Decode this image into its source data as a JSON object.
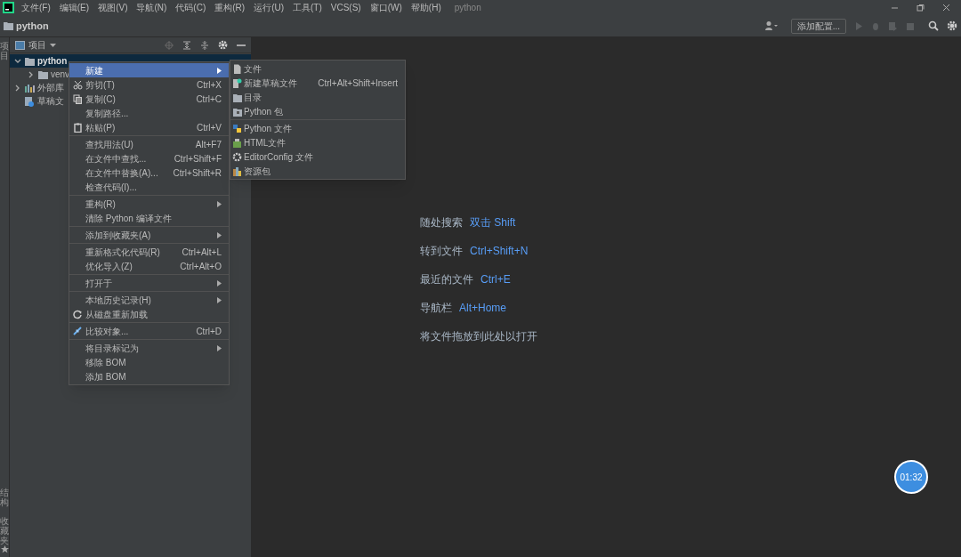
{
  "menu_bar": {
    "items": [
      "文件(F)",
      "编辑(E)",
      "视图(V)",
      "导航(N)",
      "代码(C)",
      "重构(R)",
      "运行(U)",
      "工具(T)",
      "VCS(S)",
      "窗口(W)",
      "帮助(H)"
    ],
    "title": "python"
  },
  "nav_bar": {
    "breadcrumb": "python",
    "config_button": "添加配置..."
  },
  "left_stripe": {
    "tabs": [
      "项目",
      "结构",
      "收藏夹"
    ]
  },
  "project_panel": {
    "title": "项目",
    "tree": [
      {
        "label": "python",
        "expanded": true,
        "children": [
          {
            "label": "venv",
            "expanded": false
          }
        ]
      },
      {
        "label": "外部库",
        "expanded": false
      },
      {
        "label": "草稿文"
      }
    ]
  },
  "context_menu": {
    "items": [
      {
        "kind": "item",
        "label": "新建",
        "submenu": true,
        "selected": true
      },
      {
        "kind": "item",
        "label": "剪切(T)",
        "shortcut": "Ctrl+X",
        "selected": false
      },
      {
        "kind": "item",
        "label": "复制(C)",
        "shortcut": "Ctrl+C",
        "selected": false
      },
      {
        "kind": "item",
        "label": "复制路径...",
        "selected": false
      },
      {
        "kind": "item",
        "label": "粘贴(P)",
        "shortcut": "Ctrl+V",
        "selected": false
      },
      {
        "kind": "separator"
      },
      {
        "kind": "item",
        "label": "查找用法(U)",
        "shortcut": "Alt+F7",
        "selected": false
      },
      {
        "kind": "item",
        "label": "在文件中查找...",
        "shortcut": "Ctrl+Shift+F",
        "selected": false
      },
      {
        "kind": "item",
        "label": "在文件中替换(A)...",
        "shortcut": "Ctrl+Shift+R",
        "selected": false
      },
      {
        "kind": "item",
        "label": "检查代码(I)...",
        "selected": false
      },
      {
        "kind": "separator"
      },
      {
        "kind": "item",
        "label": "重构(R)",
        "submenu": true,
        "selected": false
      },
      {
        "kind": "item",
        "label": "清除 Python 编译文件",
        "selected": false
      },
      {
        "kind": "separator"
      },
      {
        "kind": "item",
        "label": "添加到收藏夹(A)",
        "submenu": true,
        "selected": false
      },
      {
        "kind": "separator"
      },
      {
        "kind": "item",
        "label": "重新格式化代码(R)",
        "shortcut": "Ctrl+Alt+L",
        "selected": false
      },
      {
        "kind": "item",
        "label": "优化导入(Z)",
        "shortcut": "Ctrl+Alt+O",
        "selected": false
      },
      {
        "kind": "separator"
      },
      {
        "kind": "item",
        "label": "打开于",
        "submenu": true,
        "selected": false
      },
      {
        "kind": "separator"
      },
      {
        "kind": "item",
        "label": "本地历史记录(H)",
        "submenu": true,
        "selected": false
      },
      {
        "kind": "item",
        "label": "从磁盘重新加载",
        "selected": false
      },
      {
        "kind": "separator"
      },
      {
        "kind": "item",
        "label": "比较对象...",
        "shortcut": "Ctrl+D",
        "selected": false
      },
      {
        "kind": "separator"
      },
      {
        "kind": "item",
        "label": "将目录标记为",
        "submenu": true,
        "selected": false
      },
      {
        "kind": "item",
        "label": "移除 BOM",
        "selected": false
      },
      {
        "kind": "item",
        "label": "添加 BOM",
        "selected": false
      }
    ]
  },
  "submenu": {
    "items": [
      {
        "kind": "item",
        "label": "文件"
      },
      {
        "kind": "item",
        "label": "新建草稿文件",
        "shortcut": "Ctrl+Alt+Shift+Insert"
      },
      {
        "kind": "item",
        "label": "目录"
      },
      {
        "kind": "item",
        "label": "Python 包"
      },
      {
        "kind": "separator"
      },
      {
        "kind": "item",
        "label": "Python 文件"
      },
      {
        "kind": "item",
        "label": "HTML文件"
      },
      {
        "kind": "item",
        "label": "EditorConfig 文件"
      },
      {
        "kind": "item",
        "label": "资源包"
      }
    ]
  },
  "welcome_hints": [
    {
      "label": "随处搜索",
      "shortcut": "双击 Shift"
    },
    {
      "label": "转到文件",
      "shortcut": "Ctrl+Shift+N"
    },
    {
      "label": "最近的文件",
      "shortcut": "Ctrl+E"
    },
    {
      "label": "导航栏",
      "shortcut": "Alt+Home"
    },
    {
      "label": "将文件拖放到此处以打开"
    }
  ],
  "timer_badge": "01:32"
}
